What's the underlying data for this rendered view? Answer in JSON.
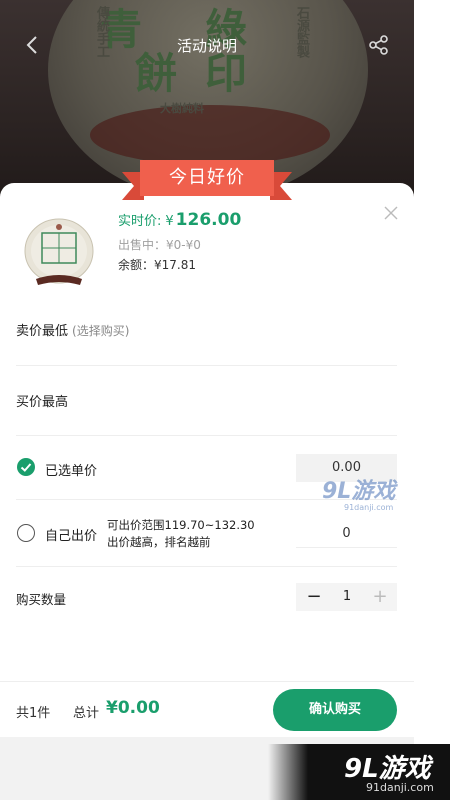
{
  "header": {
    "title": "活动说明",
    "back_icon": "back-arrow-icon",
    "share_icon": "share-icon"
  },
  "hero": {
    "stamp_chars": [
      "青",
      "綠",
      "餅",
      "印"
    ],
    "side_text_left": "傳統手工",
    "side_text_right": "石源監製",
    "bottom_text": "大樹純料"
  },
  "ribbon": {
    "label": "今日好价"
  },
  "product": {
    "price_label": "实时价:",
    "currency": "¥",
    "price": "126.00",
    "selling_text": "出售中：¥0-¥0",
    "balance_text": "余额：¥17.81"
  },
  "rows": {
    "lowest_sell": "卖价最低",
    "lowest_sell_hint": "(选择购买)",
    "highest_buy": "买价最高",
    "selected_unit": "已选单价",
    "selected_unit_value": "0.00",
    "own_bid": "自己出价",
    "own_bid_range": "可出价范围119.70~132.30",
    "own_bid_note": "出价越高，排名越前",
    "own_bid_value": "0",
    "quantity_label": "购买数量",
    "quantity": "1"
  },
  "footer": {
    "count": "共1件",
    "total_label": "总计",
    "total_amount": "¥0.00",
    "buy_button": "确认购买"
  },
  "watermarks": {
    "center_big": "9L游戏",
    "center_small": "91danji.com",
    "corner_big": "9L游戏",
    "corner_small": "91danji.com"
  },
  "colors": {
    "accent": "#1a9e6c",
    "ribbon": "#f0604d"
  }
}
